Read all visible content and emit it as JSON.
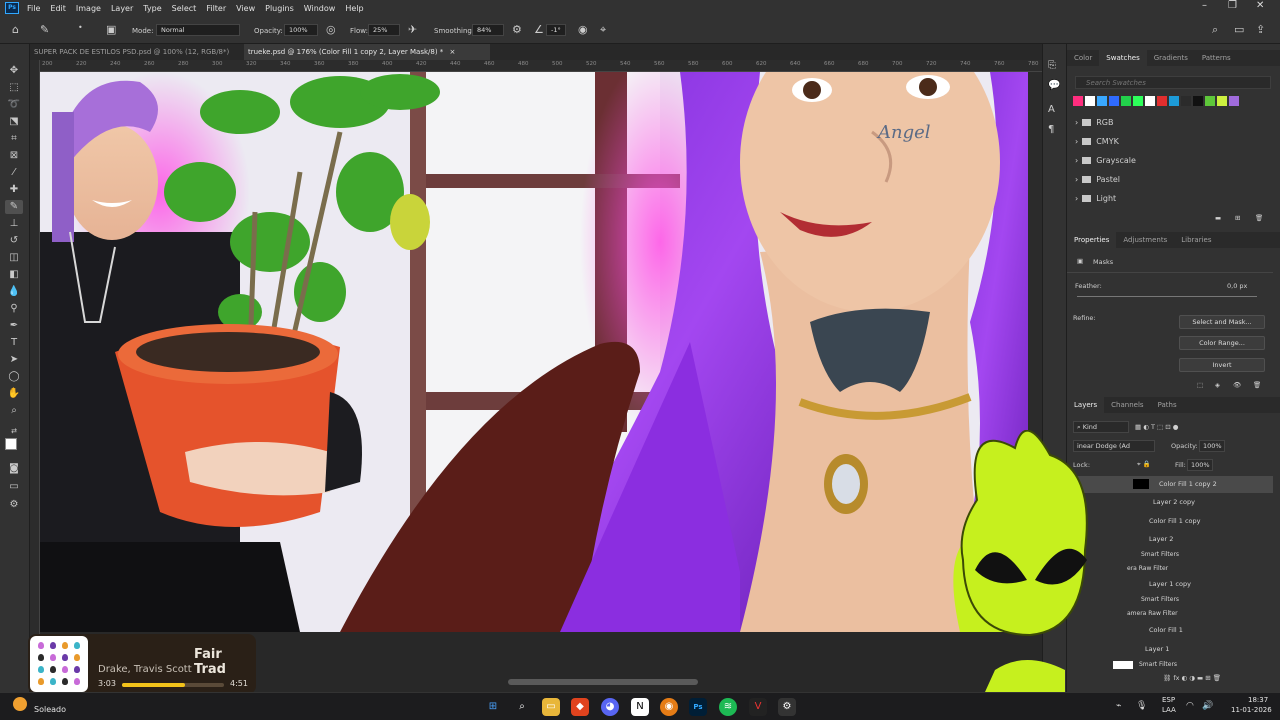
{
  "app": {
    "logo": "Ps",
    "menu": [
      "File",
      "Edit",
      "Image",
      "Layer",
      "Type",
      "Select",
      "Filter",
      "View",
      "Plugins",
      "Window",
      "Help"
    ]
  },
  "options": {
    "mode_label": "Mode:",
    "mode_value": "Normal",
    "opacity_label": "Opacity:",
    "opacity_value": "100%",
    "flow_label": "Flow:",
    "flow_value": "25%",
    "smoothing_label": "Smoothing:",
    "smoothing_value": "84%",
    "angle_value": "-1°"
  },
  "tabs": [
    {
      "label": "SUPER PACK DE ESTILOS PSD.psd @ 100% (12, RGB/8*)"
    },
    {
      "label": "trueke.psd @ 176% (Color Fill 1 copy 2, Layer Mask/8) *"
    }
  ],
  "ruler": [
    "200",
    "220",
    "240",
    "260",
    "280",
    "300",
    "320",
    "340",
    "360",
    "380",
    "400",
    "420",
    "440",
    "460",
    "480",
    "500",
    "520",
    "540",
    "560",
    "580",
    "600",
    "620",
    "640",
    "660",
    "680",
    "700",
    "720",
    "740",
    "760",
    "780"
  ],
  "canvas": {
    "face_tattoo": "Angel"
  },
  "swatches_panel": {
    "tabs": [
      "Color",
      "Swatches",
      "Gradients",
      "Patterns"
    ],
    "active_tab": "Swatches",
    "search_placeholder": "Search Swatches",
    "colors": [
      "#ff2d7e",
      "#ffffff",
      "#39a8ff",
      "#2f6bff",
      "#22d14b",
      "#2dff5a",
      "#ffffff",
      "#e12e2e",
      "#1d9bd8",
      "#2b2b2b",
      "#111111",
      "#5ec73a",
      "#cdf040",
      "#a06bdc"
    ],
    "folders": [
      "RGB",
      "CMYK",
      "Grayscale",
      "Pastel",
      "Light"
    ]
  },
  "properties_panel": {
    "tabs": [
      "Properties",
      "Adjustments",
      "Libraries"
    ],
    "active_tab": "Properties",
    "masks_label": "Masks",
    "feather_label": "Feather:",
    "feather_value": "0,0 px",
    "refine_label": "Refine:",
    "select_mask_button": "Select and Mask...",
    "color_range_button": "Color Range...",
    "invert_button": "Invert"
  },
  "layers_panel": {
    "tabs": [
      "Layers",
      "Channels",
      "Paths"
    ],
    "active_tab": "Layers",
    "kind_label": "Kind",
    "blend_mode": "inear Dodge (Ad",
    "opacity_label": "Opacity:",
    "opacity_value": "100%",
    "lock_label": "Lock:",
    "fill_label": "Fill:",
    "fill_value": "100%",
    "layers": [
      {
        "name": "Color Fill 1 copy 2"
      },
      {
        "name": "Layer 2 copy"
      },
      {
        "name": "Color Fill 1 copy"
      },
      {
        "name": "Layer 2"
      },
      {
        "name": "Smart Filters"
      },
      {
        "name": "era Raw Filter"
      },
      {
        "name": "Layer 1 copy"
      },
      {
        "name": "Smart Filters"
      },
      {
        "name": "amera Raw Filter"
      },
      {
        "name": "Color Fill 1"
      },
      {
        "name": "Layer 1"
      },
      {
        "name": "Smart Filters"
      }
    ]
  },
  "media": {
    "title": "Fair Trad",
    "artists": "Drake, Travis Scott",
    "elapsed": "3:03",
    "total": "4:51",
    "progress": 0.62
  },
  "taskbar": {
    "weather": "Soleado",
    "lang_top": "ESP",
    "lang_bottom": "LAA",
    "time": "18:37",
    "date": "11-01-2026"
  }
}
